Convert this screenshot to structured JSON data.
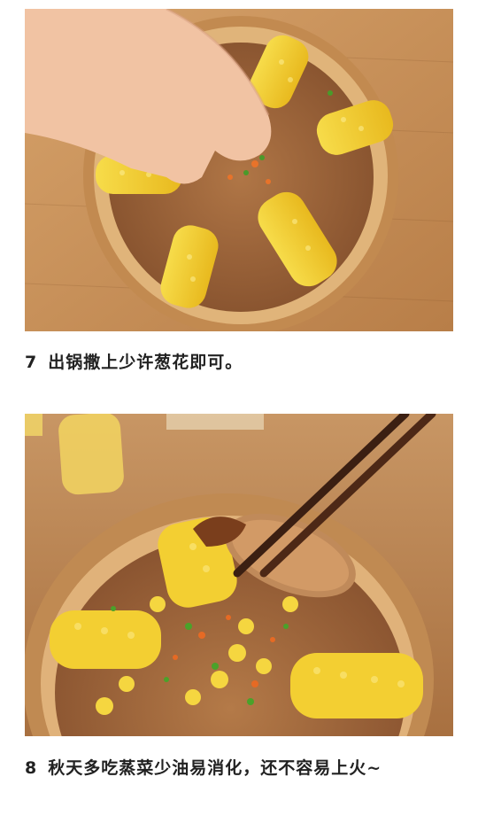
{
  "steps": [
    {
      "number": "7",
      "text": "出锅撒上少许葱花即可。",
      "photo_icon": "steamed-rice-corn-bamboo-steamer-image"
    },
    {
      "number": "8",
      "text": "秋天多吃蒸菜少油易消化，还不容易上火~",
      "photo_icon": "chopsticks-lifting-sticky-rice-image"
    }
  ],
  "colors": {
    "wood": "#c9925a",
    "bamboo": "#d9a86a",
    "rice": "#a06a3c",
    "corn": "#f4d23a",
    "scallion": "#4a9a2a"
  }
}
